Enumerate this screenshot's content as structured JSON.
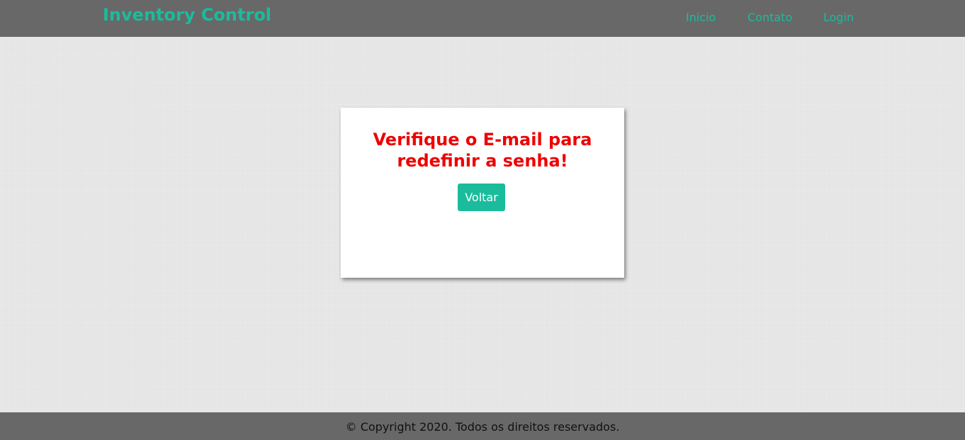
{
  "header": {
    "brand": "Inventory Control",
    "nav": {
      "inicio": "Inicio",
      "contato": "Contato",
      "login": "Login"
    }
  },
  "card": {
    "message_line1": "Verifique o E-mail para",
    "message_line2": "redefinir a senha!",
    "back_label": "Voltar"
  },
  "footer": {
    "copyright": "© Copyright 2020. Todos os direitos reservados."
  },
  "colors": {
    "accent": "#1abc9c",
    "bar": "#686868",
    "alert": "#ee0000",
    "background": "#e3e3e3"
  }
}
